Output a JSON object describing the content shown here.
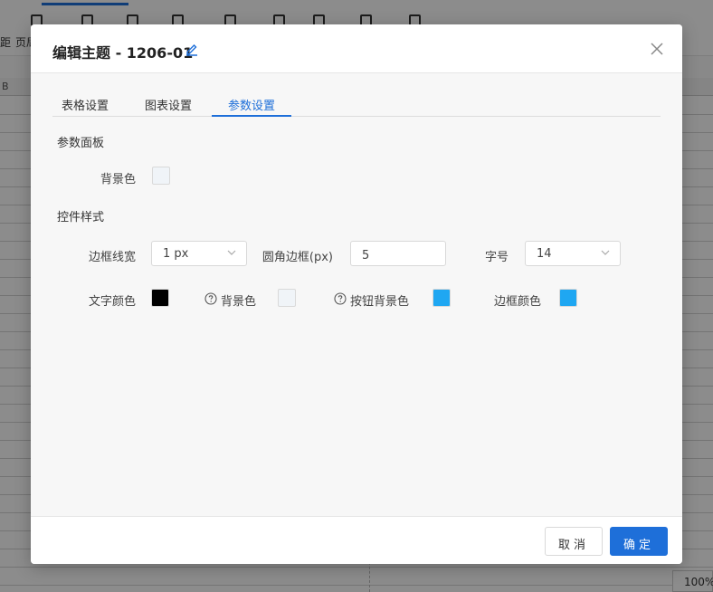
{
  "background": {
    "toolbar_texts": [
      "距",
      "页局"
    ],
    "column_letter": "B",
    "zoom": "100%"
  },
  "modal": {
    "title": "编辑主题 - 1206-01",
    "icons": {
      "edit": "pencil-icon",
      "close": "close-icon"
    },
    "tabs": [
      {
        "label": "表格设置",
        "active": false
      },
      {
        "label": "图表设置",
        "active": false
      },
      {
        "label": "参数设置",
        "active": true
      }
    ],
    "param_panel": {
      "section_title": "参数面板",
      "bg_color_label": "背景色",
      "bg_color": "#f0f4f8"
    },
    "control_style": {
      "section_title": "控件样式",
      "border_width": {
        "label": "边框线宽",
        "value": "1 px"
      },
      "border_radius": {
        "label": "圆角边框(px)",
        "value": "5"
      },
      "font_size": {
        "label": "字号",
        "value": "14"
      },
      "text_color": {
        "label": "文字颜色",
        "color": "#000000"
      },
      "bg_color": {
        "label": "背景色",
        "color": "#f0f4f8"
      },
      "button_bg_color": {
        "label": "按钮背景色",
        "color": "#1fa7f2"
      },
      "border_color": {
        "label": "边框颜色",
        "color": "#1fa7f2"
      }
    },
    "footer": {
      "cancel_label": "取消",
      "ok_label": "确定"
    }
  },
  "colors": {
    "accent": "#1e6fd9"
  }
}
